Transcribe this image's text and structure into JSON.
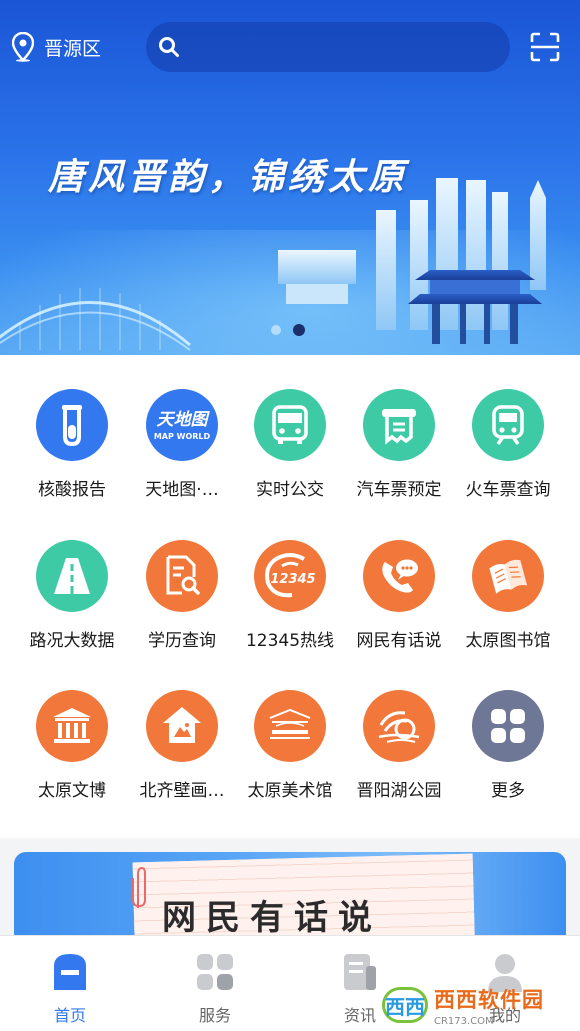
{
  "header": {
    "location": "晋源区",
    "search_placeholder": "",
    "slogan": "唐风晋韵，锦绣太原"
  },
  "carousel": {
    "total": 2,
    "active": 2
  },
  "apps": [
    {
      "label": "核酸报告",
      "icon": "test-tube-icon",
      "color": "#3478f0"
    },
    {
      "label": "天地图·…",
      "icon": "tianditu-logo",
      "color": "#3478f0",
      "logo_text": "天地图",
      "logo_sub": "MAP WORLD"
    },
    {
      "label": "实时公交",
      "icon": "bus-icon",
      "color": "#3fcaa6"
    },
    {
      "label": "汽车票预定",
      "icon": "ticket-icon",
      "color": "#3fcaa6"
    },
    {
      "label": "火车票查询",
      "icon": "train-icon",
      "color": "#3fcaa6"
    },
    {
      "label": "路况大数据",
      "icon": "road-icon",
      "color": "#3fcaa6"
    },
    {
      "label": "学历查询",
      "icon": "document-search-icon",
      "color": "#f1783a"
    },
    {
      "label": "12345热线",
      "icon": "hotline-12345-icon",
      "color": "#f1783a",
      "logo_text": "12345"
    },
    {
      "label": "网民有话说",
      "icon": "phone-chat-icon",
      "color": "#f1783a"
    },
    {
      "label": "太原图书馆",
      "icon": "book-icon",
      "color": "#f1783a"
    },
    {
      "label": "太原文博",
      "icon": "museum-icon",
      "color": "#f1783a"
    },
    {
      "label": "北齐壁画…",
      "icon": "mural-house-icon",
      "color": "#f1783a"
    },
    {
      "label": "太原美术馆",
      "icon": "art-museum-logo",
      "color": "#f1783a"
    },
    {
      "label": "晋阳湖公园",
      "icon": "park-logo",
      "color": "#f1783a"
    },
    {
      "label": "更多",
      "icon": "grid-more-icon",
      "color": "#6e7796"
    }
  ],
  "promo": {
    "title": "网民有话说"
  },
  "tabs": [
    {
      "label": "首页",
      "active": true
    },
    {
      "label": "服务",
      "active": false
    },
    {
      "label": "资讯",
      "active": false
    },
    {
      "label": "我的",
      "active": false
    }
  ],
  "watermark": {
    "logo": "西西",
    "main": "西西软件园",
    "url": "CR173.COM"
  }
}
